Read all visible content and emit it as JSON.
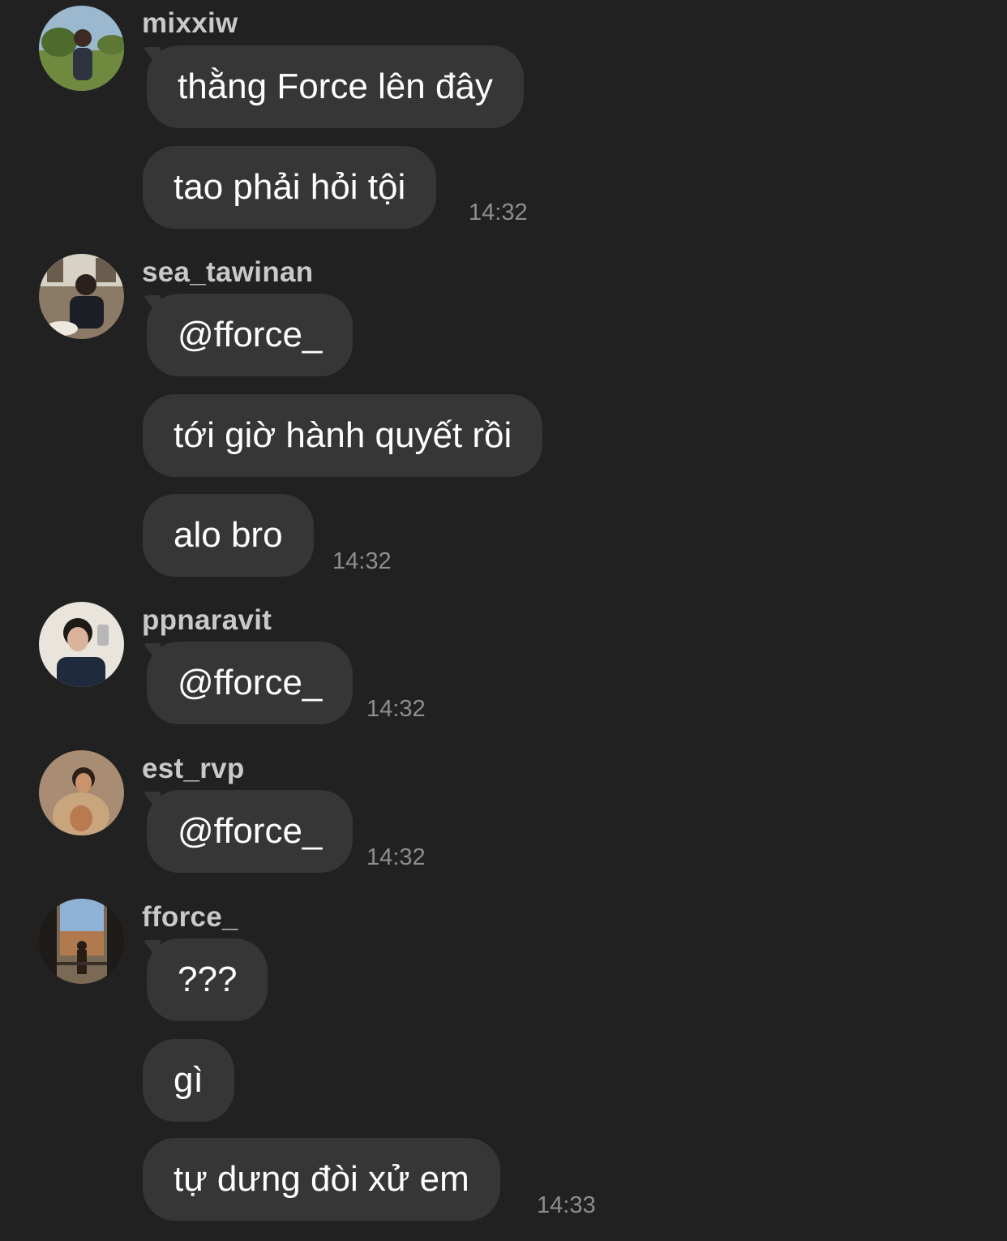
{
  "messages": [
    {
      "user": "mixxiw",
      "bubbles": [
        "thằng Force lên đây",
        "tao phải hỏi tội"
      ],
      "time": "14:32"
    },
    {
      "user": "sea_tawinan",
      "bubbles": [
        "@fforce_",
        "tới giờ hành quyết rồi",
        "alo bro"
      ],
      "time": "14:32"
    },
    {
      "user": "ppnaravit",
      "bubbles": [
        "@fforce_"
      ],
      "time": "14:32"
    },
    {
      "user": "est_rvp",
      "bubbles": [
        "@fforce_"
      ],
      "time": "14:32"
    },
    {
      "user": "fforce_",
      "bubbles": [
        "???",
        "gì",
        "tự dưng đòi xử em"
      ],
      "time": "14:33"
    }
  ],
  "colors": {
    "background": "#212121",
    "bubble": "#363636",
    "text": "#ffffff",
    "username": "#c9c9c9",
    "timestamp": "#8e8e8e"
  }
}
